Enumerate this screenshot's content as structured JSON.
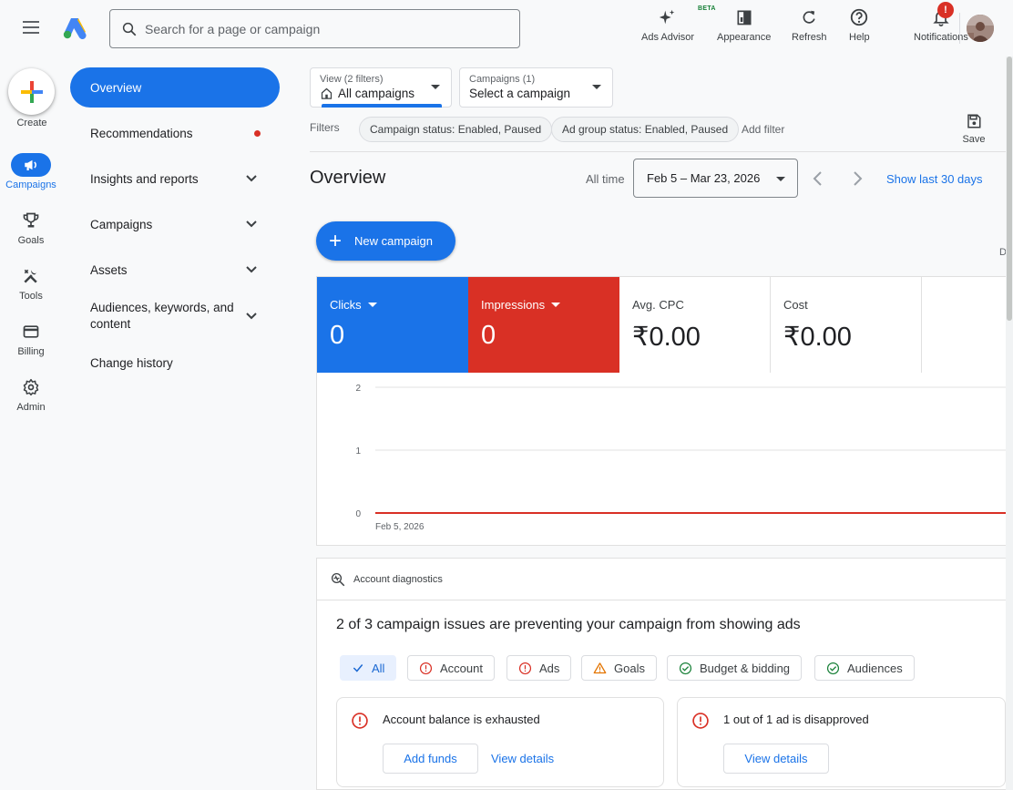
{
  "search": {
    "placeholder": "Search for a page or campaign"
  },
  "toolbar": {
    "ads_advisor": "Ads Advisor",
    "beta": "BETA",
    "appearance": "Appearance",
    "refresh": "Refresh",
    "help": "Help",
    "notifications": "Notifications",
    "notif_badge": "!"
  },
  "rail": {
    "create": "Create",
    "campaigns": "Campaigns",
    "goals": "Goals",
    "tools": "Tools",
    "billing": "Billing",
    "admin": "Admin"
  },
  "nav": {
    "items": [
      {
        "label": "Overview"
      },
      {
        "label": "Recommendations"
      },
      {
        "label": "Insights and reports"
      },
      {
        "label": "Campaigns"
      },
      {
        "label": "Assets"
      },
      {
        "label": "Audiences, keywords, and content"
      },
      {
        "label": "Change history"
      }
    ]
  },
  "view_select": {
    "caption": "View (2 filters)",
    "value": "All campaigns"
  },
  "campaign_select": {
    "caption": "Campaigns (1)",
    "value": "Select a campaign"
  },
  "filters": {
    "label": "Filters",
    "chips": [
      "Campaign status: Enabled, Paused",
      "Ad group status: Enabled, Paused"
    ],
    "add": "Add filter",
    "save": "Save"
  },
  "overview": {
    "title": "Overview",
    "all_time": "All time",
    "date_range": "Feb 5 – Mar 23, 2026",
    "show_last": "Show last 30 days",
    "new_campaign": "New campaign",
    "cut_label": "D"
  },
  "metrics": [
    {
      "label": "Clicks",
      "value": "0"
    },
    {
      "label": "Impressions",
      "value": "0"
    },
    {
      "label": "Avg. CPC",
      "value": "₹0.00"
    },
    {
      "label": "Cost",
      "value": "₹0.00"
    }
  ],
  "colors": {
    "accent": "#1a73e8",
    "clicks": "#1a73e8",
    "impressions": "#d93025",
    "warning": "#e37400",
    "ok": "#188038"
  },
  "chart_data": {
    "type": "line",
    "x": [
      "Feb 5, 2026"
    ],
    "x_tick_labels": [
      "Feb 5, 2026"
    ],
    "series": [
      {
        "name": "Clicks",
        "values": [
          0
        ]
      },
      {
        "name": "Impressions",
        "values": [
          0
        ]
      }
    ],
    "ylim": [
      0,
      2
    ],
    "y_ticks": [
      "0",
      "1",
      "2"
    ],
    "grid": true
  },
  "diagnostics": {
    "header": "Account diagnostics",
    "title": "2 of 3 campaign issues are preventing your campaign from showing ads",
    "filters": [
      {
        "label": "All",
        "icon": "check-icon"
      },
      {
        "label": "Account",
        "icon": "error-icon"
      },
      {
        "label": "Ads",
        "icon": "error-icon"
      },
      {
        "label": "Goals",
        "icon": "warning-icon"
      },
      {
        "label": "Budget & bidding",
        "icon": "check-circle-icon"
      },
      {
        "label": "Audiences",
        "icon": "check-circle-icon"
      }
    ],
    "issues": [
      {
        "title": "Account balance is exhausted",
        "primary": "Add funds",
        "secondary": "View details"
      },
      {
        "title": "1 out of 1 ad is disapproved",
        "primary": "View details"
      }
    ]
  }
}
